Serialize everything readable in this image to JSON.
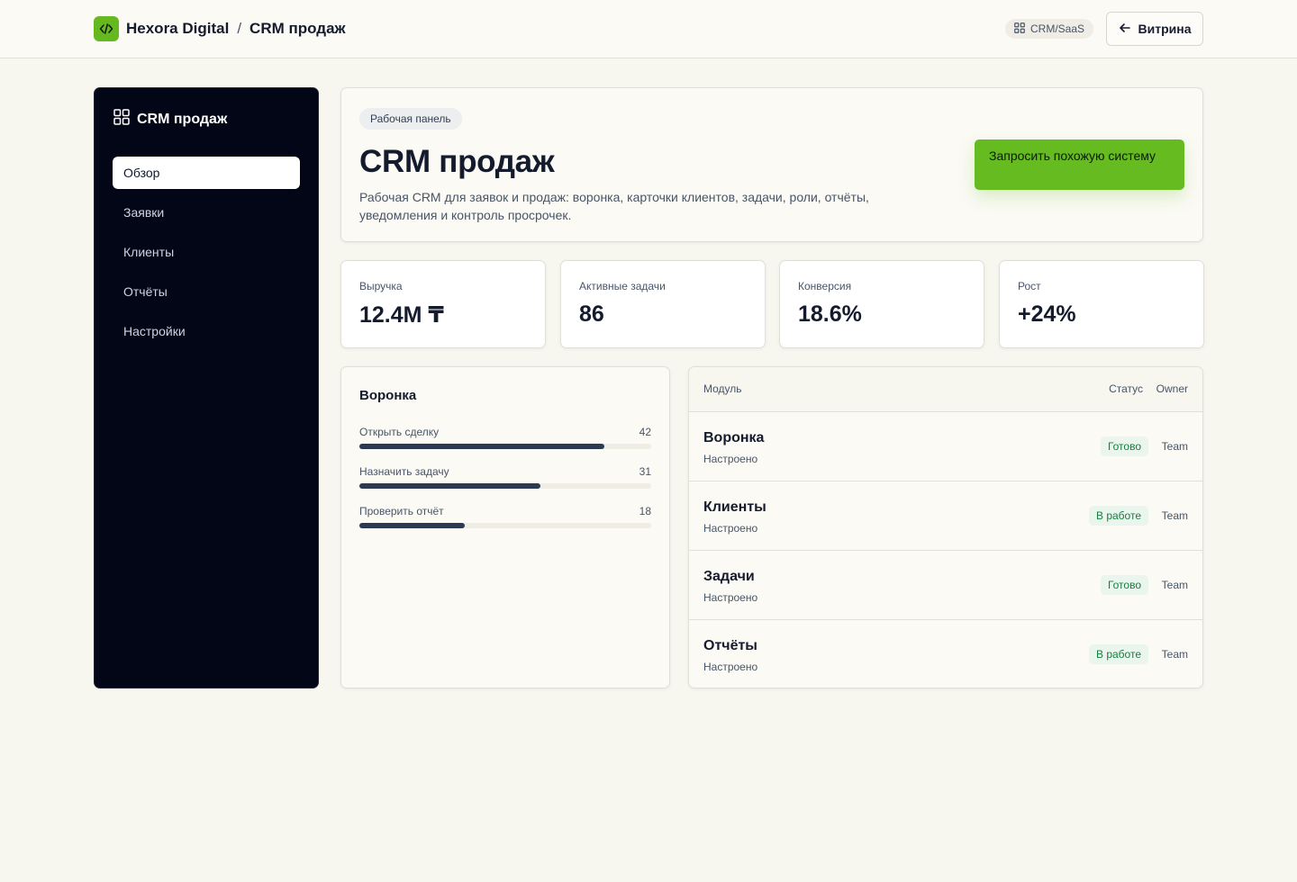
{
  "header": {
    "brand": "Hexora Digital",
    "separator": "/",
    "page": "CRM продаж",
    "tag": "CRM/SaaS",
    "back_label": "Витрина"
  },
  "sidebar": {
    "title": "CRM продаж",
    "items": [
      {
        "label": "Обзор",
        "active": true
      },
      {
        "label": "Заявки",
        "active": false
      },
      {
        "label": "Клиенты",
        "active": false
      },
      {
        "label": "Отчёты",
        "active": false
      },
      {
        "label": "Настройки",
        "active": false
      }
    ]
  },
  "hero": {
    "badge": "Рабочая панель",
    "title": "CRM продаж",
    "description": "Рабочая CRM для заявок и продаж: воронка, карточки клиентов, задачи, роли, отчёты, уведомления и контроль просрочек.",
    "cta_label": "Запросить похожую систему"
  },
  "metrics": [
    {
      "label": "Выручка",
      "value": "12.4M ₸"
    },
    {
      "label": "Активные задачи",
      "value": "86"
    },
    {
      "label": "Конверсия",
      "value": "18.6%"
    },
    {
      "label": "Рост",
      "value": "+24%"
    }
  ],
  "funnel": {
    "title": "Воронка",
    "max": 50,
    "rows": [
      {
        "label": "Открыть сделку",
        "value": 42
      },
      {
        "label": "Назначить задачу",
        "value": 31
      },
      {
        "label": "Проверить отчёт",
        "value": 18
      }
    ]
  },
  "table": {
    "columns": {
      "module": "Модуль",
      "status": "Статус",
      "owner": "Owner"
    },
    "rows": [
      {
        "name": "Воронка",
        "sub": "Настроено",
        "status": "Готово",
        "owner": "Team"
      },
      {
        "name": "Клиенты",
        "sub": "Настроено",
        "status": "В работе",
        "owner": "Team"
      },
      {
        "name": "Задачи",
        "sub": "Настроено",
        "status": "Готово",
        "owner": "Team"
      },
      {
        "name": "Отчёты",
        "sub": "Настроено",
        "status": "В работе",
        "owner": "Team"
      }
    ]
  },
  "colors": {
    "accent": "#66bb21",
    "sidebar_bg": "#030617",
    "bar_fill": "#2b3a52",
    "status_text": "#15803d",
    "status_bg": "#eaf5ee"
  }
}
